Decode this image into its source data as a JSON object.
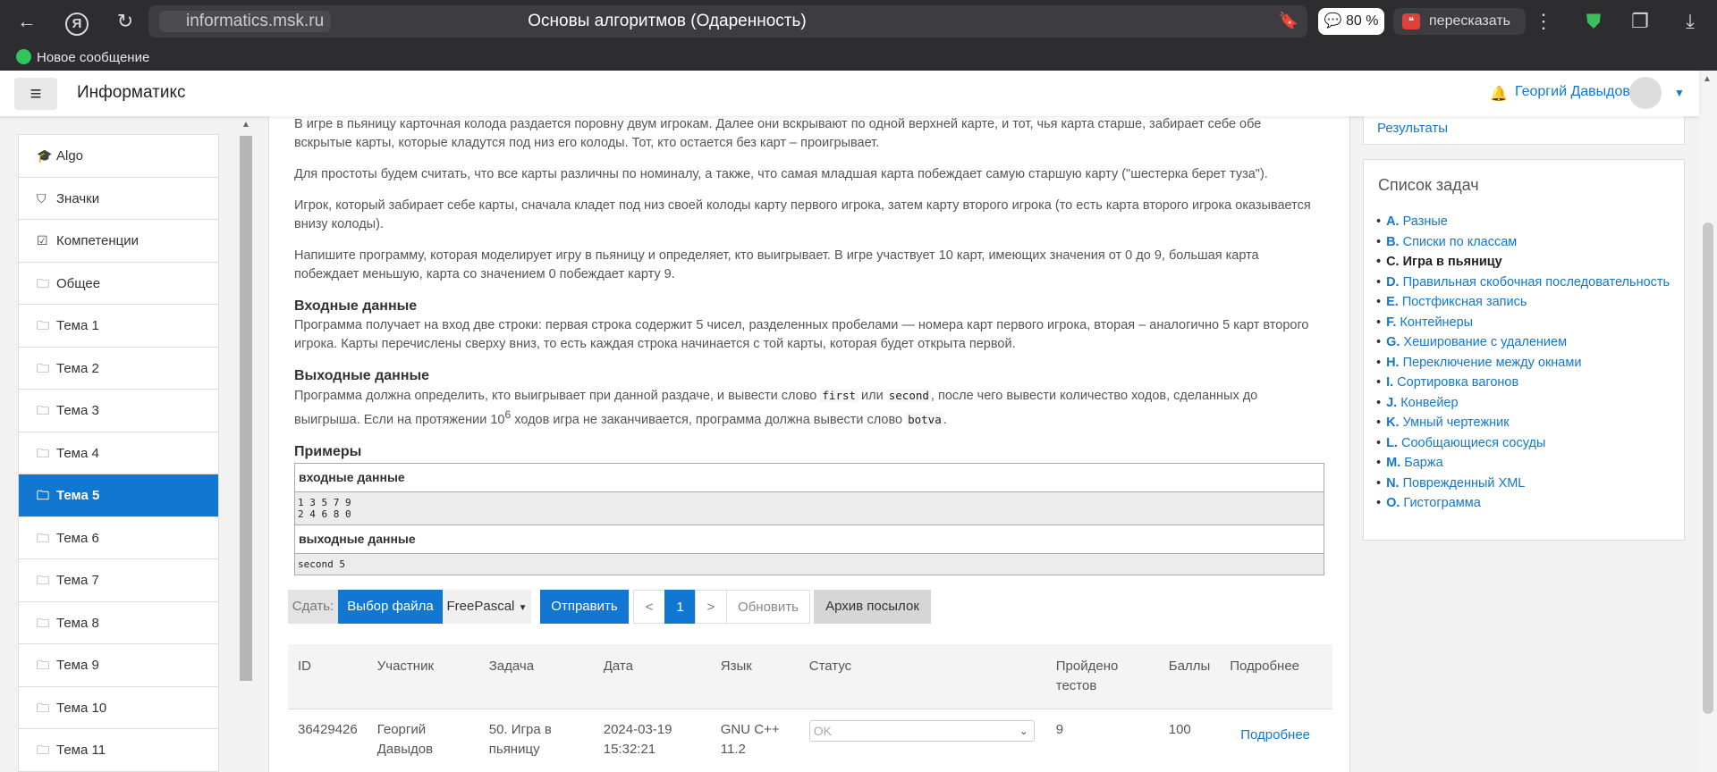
{
  "browser": {
    "url": "informatics.msk.ru",
    "tab_title": "Основы алгоритмов (Одаренность)",
    "zoom": "80 %",
    "retell": "пересказать",
    "message": "Новое сообщение"
  },
  "navbar": {
    "brand": "Информатикс",
    "user": "Георгий Давыдов"
  },
  "sidebar": {
    "items": [
      {
        "label": "Algo",
        "icon": "graduation-cap-icon"
      },
      {
        "label": "Значки",
        "icon": "shield-icon"
      },
      {
        "label": "Компетенции",
        "icon": "checkbox-icon"
      },
      {
        "label": "Общее",
        "icon": "folder-icon"
      },
      {
        "label": "Тема 1",
        "icon": "folder-icon"
      },
      {
        "label": "Тема 2",
        "icon": "folder-icon"
      },
      {
        "label": "Тема 3",
        "icon": "folder-icon"
      },
      {
        "label": "Тема 4",
        "icon": "folder-icon"
      },
      {
        "label": "Тема 5",
        "icon": "folder-icon",
        "active": true
      },
      {
        "label": "Тема 6",
        "icon": "folder-icon"
      },
      {
        "label": "Тема 7",
        "icon": "folder-icon"
      },
      {
        "label": "Тема 8",
        "icon": "folder-icon"
      },
      {
        "label": "Тема 9",
        "icon": "folder-icon"
      },
      {
        "label": "Тема 10",
        "icon": "folder-icon"
      },
      {
        "label": "Тема 11",
        "icon": "folder-icon"
      }
    ]
  },
  "problem": {
    "p1": "В игре в пьяницу карточная колода раздается поровну двум игрокам. Далее они вскрывают по одной верхней карте, и тот, чья карта старше, забирает себе обе вскрытые карты, которые кладутся под низ его колоды. Тот, кто остается без карт – проигрывает.",
    "p2": "Для простоты будем считать, что все карты различны по номиналу, а также, что самая младшая карта побеждает самую старшую карту (\"шестерка берет туза\").",
    "p3": "Игрок, который забирает себе карты, сначала кладет под низ своей колоды карту первого игрока, затем карту второго игрока (то есть карта второго игрока оказывается внизу колоды).",
    "p4": "Напишите программу, которая моделирует игру в пьяницу и определяет, кто выигрывает. В игре участвует 10 карт, имеющих значения от 0 до 9, большая карта побеждает меньшую, карта со значением 0 побеждает карту 9.",
    "input_title": "Входные данные",
    "input_text": "Программа получает на вход две строки: первая строка содержит 5 чисел, разделенных пробелами — номера карт первого игрока, вторая – аналогично 5 карт второго игрока. Карты перечислены сверху вниз, то есть каждая строка начинается с той карты, которая будет открыта первой.",
    "output_title": "Выходные данные",
    "output_a": "Программа должна определить, кто выигрывает при данной раздаче, и вывести слово ",
    "output_first": "first",
    "output_or": " или ",
    "output_second": "second",
    "output_b": ", после чего вывести количество ходов, сделанных до выигрыша. Если на протяжении 10",
    "output_exp": "6",
    "output_c": " ходов игра не заканчивается, программа должна вывести слово ",
    "output_botva": "botva",
    "output_d": ".",
    "examples_title": "Примеры",
    "input_label": "входные данные",
    "example_input": "1 3 5 7 9\n2 4 6 8 0",
    "output_label": "выходные данные",
    "example_output": "second 5"
  },
  "submit": {
    "label": "Сдать:",
    "file_button": "Выбор файла",
    "language": "FreePascal",
    "send": "Отправить",
    "prev": "<",
    "page": "1",
    "next": ">",
    "refresh": "Обновить",
    "archive": "Архив посылок"
  },
  "results_table": {
    "headers": [
      "ID",
      "Участник",
      "Задача",
      "Дата",
      "Язык",
      "Статус",
      "Пройдено тестов",
      "Баллы",
      "Подробнее"
    ],
    "rows": [
      {
        "id": "36429426",
        "user": "Георгий Давыдов",
        "task": "50. Игра в пьяницу",
        "date": "2024-03-19 15:32:21",
        "lang": "GNU C++ 11.2",
        "status": "OK",
        "tests": "9",
        "score": "100",
        "more": "Подробнее"
      }
    ]
  },
  "right": {
    "results_link": "Результаты",
    "tasks_title": "Список задач",
    "tasks": [
      {
        "letter": "A.",
        "name": "Разные"
      },
      {
        "letter": "B.",
        "name": "Списки по классам"
      },
      {
        "letter": "C.",
        "name": "Игра в пьяницу",
        "current": true
      },
      {
        "letter": "D.",
        "name": "Правильная скобочная последовательность"
      },
      {
        "letter": "E.",
        "name": "Постфиксная запись"
      },
      {
        "letter": "F.",
        "name": "Контейнеры"
      },
      {
        "letter": "G.",
        "name": "Хеширование с удалением"
      },
      {
        "letter": "H.",
        "name": "Переключение между окнами"
      },
      {
        "letter": "I.",
        "name": "Сортировка вагонов"
      },
      {
        "letter": "J.",
        "name": "Конвейер"
      },
      {
        "letter": "K.",
        "name": "Умный чертежник"
      },
      {
        "letter": "L.",
        "name": "Сообщающиеся сосуды"
      },
      {
        "letter": "M.",
        "name": "Баржа"
      },
      {
        "letter": "N.",
        "name": "Поврежденный XML"
      },
      {
        "letter": "O.",
        "name": "Гистограмма"
      }
    ]
  }
}
